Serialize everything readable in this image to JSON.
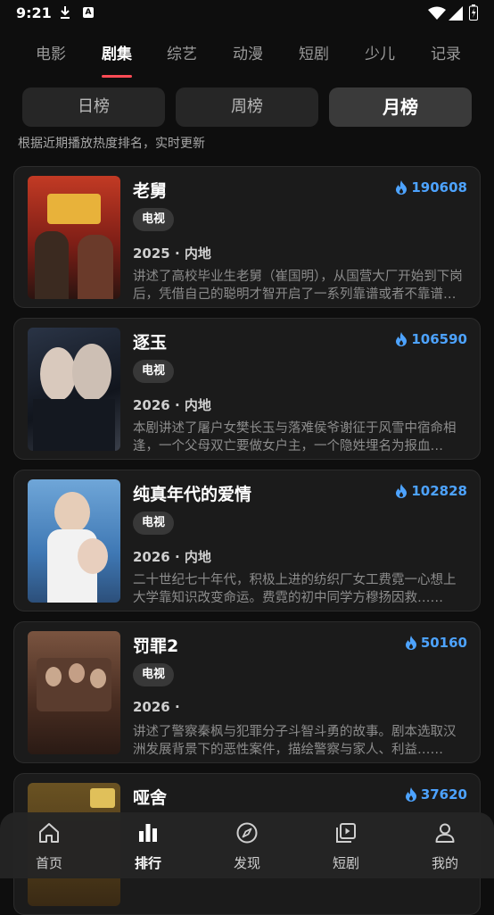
{
  "status_bar": {
    "time": "9:21",
    "notification_letter": "A"
  },
  "category_tabs": [
    "电影",
    "剧集",
    "综艺",
    "动漫",
    "短剧",
    "少儿",
    "记录"
  ],
  "active_category": "剧集",
  "periods": [
    "日榜",
    "周榜",
    "月榜"
  ],
  "active_period": "月榜",
  "subtitle": "根据近期播放热度排名，实时更新",
  "items": [
    {
      "title": "老舅",
      "hot": "190608",
      "tag": "电视",
      "meta": "2025 · 内地",
      "desc": "讲述了高校毕业生老舅（崔国明），从国营大厂开始到下岗后，凭借自己的聪明才智开启了一系列靠谱或者不靠谱的创业之路……",
      "poster_color": "#8a2a1e"
    },
    {
      "title": "逐玉",
      "hot": "106590",
      "tag": "电视",
      "meta": "2026 · 内地",
      "desc": "本剧讲述了屠户女樊长玉与落难侯爷谢征于风雪中宿命相逢，一个父母双亡要做女户主，一个隐姓埋名为报血仇……",
      "poster_color": "#1c2433"
    },
    {
      "title": "纯真年代的爱情",
      "hot": "102828",
      "tag": "电视",
      "meta": "2026 · 内地",
      "desc": "二十世纪七十年代，积极上进的纺织厂女工费霓一心想上大学靠知识改变命运。费霓的初中同学方穆扬因救……",
      "poster_color": "#3a6fa8"
    },
    {
      "title": "罚罪2",
      "hot": "50160",
      "tag": "电视",
      "meta": "2026 ·",
      "desc": "讲述了警察秦枫与犯罪分子斗智斗勇的故事。剧本选取汉洲发展背景下的恶性案件，描绘警察与家人、利益……",
      "poster_color": "#5a3a2a"
    },
    {
      "title": "哑舍",
      "hot": "37620",
      "tag": "",
      "meta": "",
      "desc": "",
      "poster_color": "#4a3a1a"
    }
  ],
  "bottom_nav": [
    "首页",
    "排行",
    "发现",
    "短剧",
    "我的"
  ],
  "active_nav": "排行",
  "colors": {
    "accent_red": "#ff4b55",
    "hot_blue": "#4da3ff",
    "background": "#0e0e0e",
    "card": "#1b1b1b"
  }
}
